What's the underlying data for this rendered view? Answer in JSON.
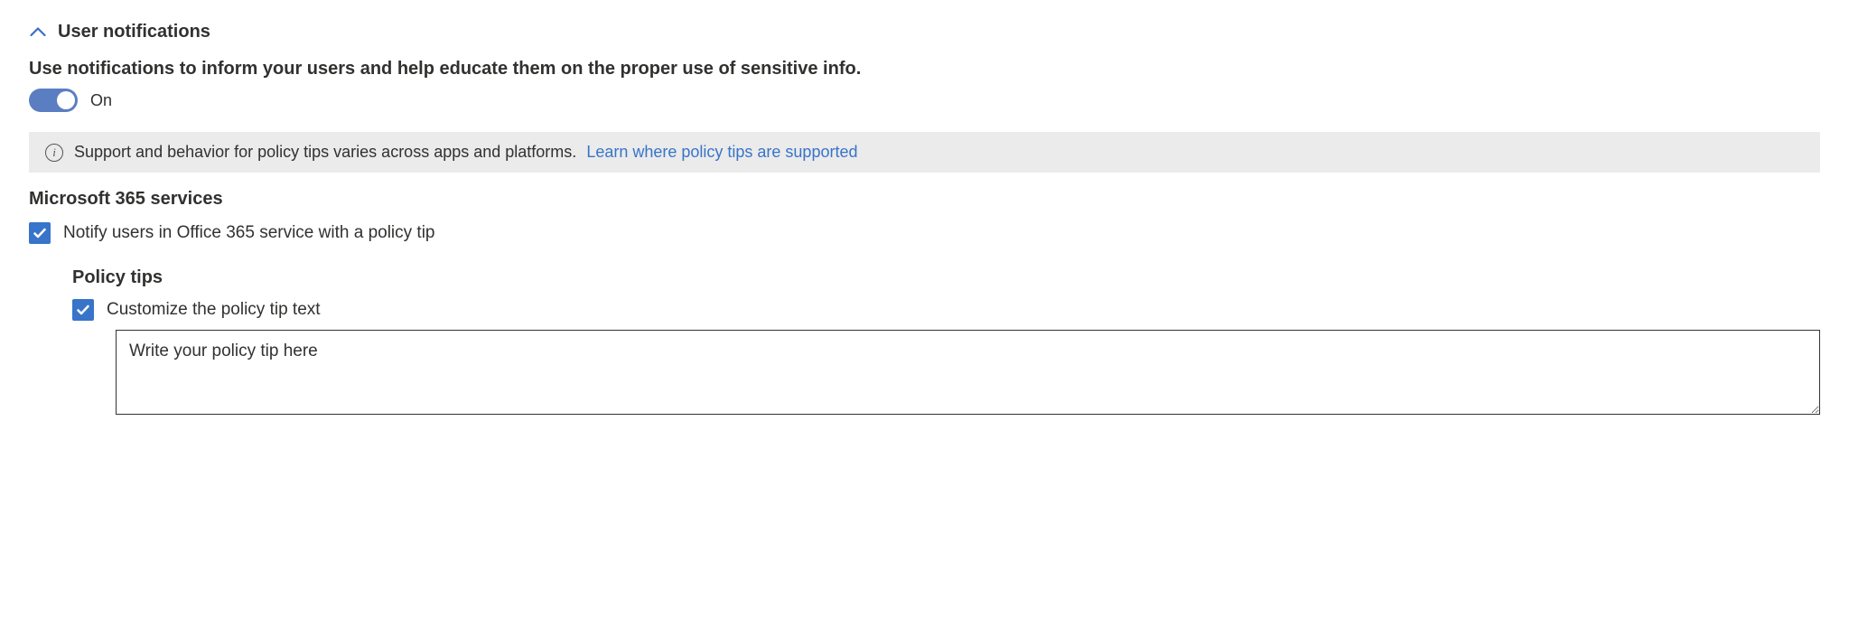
{
  "section": {
    "title": "User notifications"
  },
  "description": "Use notifications to inform your users and help educate them on the proper use of sensitive info.",
  "toggle": {
    "state_label": "On"
  },
  "info_bar": {
    "text": "Support and behavior for policy tips varies across apps and platforms.",
    "link_text": "Learn where policy tips are supported"
  },
  "services_heading": "Microsoft 365 services",
  "notify_checkbox_label": "Notify users in Office 365 service with a policy tip",
  "policy_tips": {
    "heading": "Policy tips",
    "customize_label": "Customize the policy tip text",
    "textarea_value": "Write your policy tip here"
  }
}
